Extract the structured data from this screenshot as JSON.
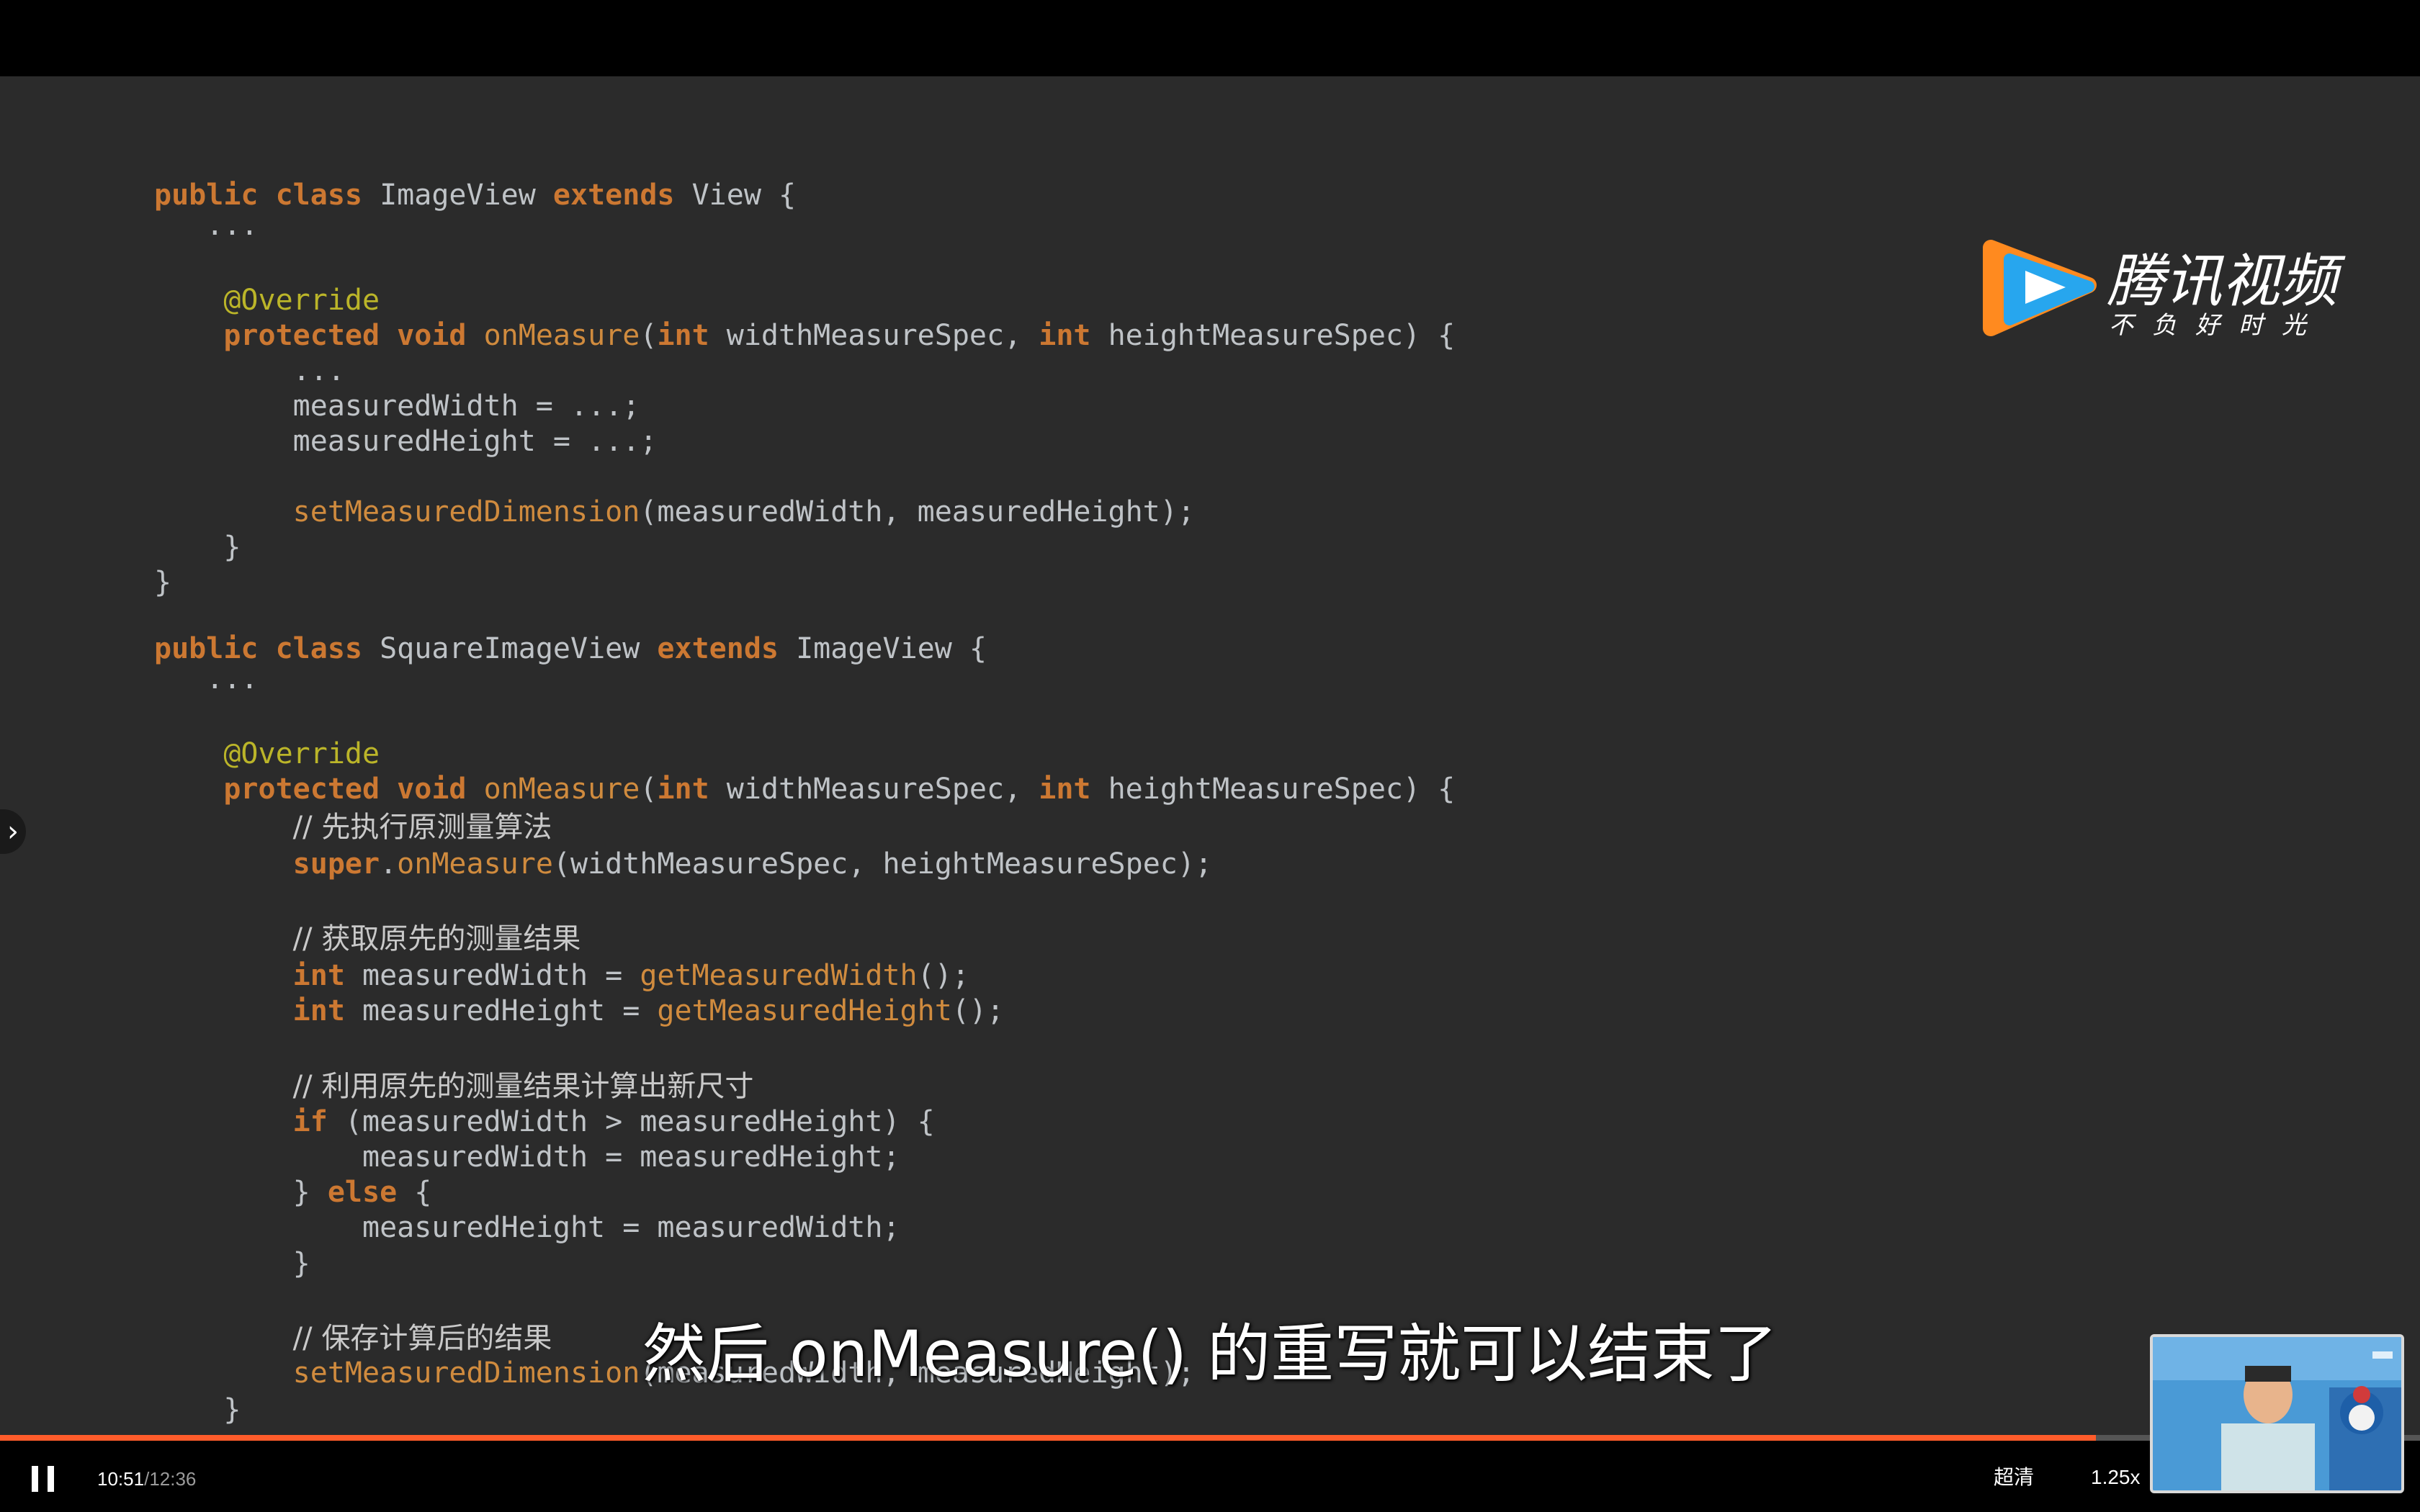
{
  "player": {
    "logo": {
      "title": "腾讯视频",
      "slogan": "不负好时光"
    },
    "subtitle": "然后 onMeasure() 的重写就可以结束了",
    "progress": {
      "current_time": "10:51",
      "separator": "/",
      "duration": "12:36",
      "played_fraction": 0.866
    },
    "controls": {
      "quality_label": "超清",
      "speed_label": "1.25x"
    },
    "side_toggle_icon": "chevron-right-icon",
    "pause_icon": "pause-icon",
    "colors": {
      "progress": "#ff5c2b",
      "background": "#2b2b2b",
      "keyword": "#cc7832"
    }
  },
  "code_lines": [
    [
      [
        "k",
        "public"
      ],
      [
        "p",
        " "
      ],
      [
        "k",
        "class"
      ],
      [
        "p",
        " ImageView "
      ],
      [
        "k",
        "extends"
      ],
      [
        "p",
        " View {"
      ]
    ],
    [
      [
        "p",
        "   ..."
      ]
    ],
    [
      [
        "p",
        ""
      ]
    ],
    [
      [
        "p",
        "    "
      ],
      [
        "a",
        "@Override"
      ]
    ],
    [
      [
        "p",
        "    "
      ],
      [
        "k",
        "protected"
      ],
      [
        "p",
        " "
      ],
      [
        "k",
        "void"
      ],
      [
        "p",
        " "
      ],
      [
        "f",
        "onMeasure"
      ],
      [
        "p",
        "("
      ],
      [
        "k",
        "int"
      ],
      [
        "p",
        " widthMeasureSpec, "
      ],
      [
        "k",
        "int"
      ],
      [
        "p",
        " heightMeasureSpec) {"
      ]
    ],
    [
      [
        "p",
        "        ..."
      ]
    ],
    [
      [
        "p",
        "        measuredWidth = ...;"
      ]
    ],
    [
      [
        "p",
        "        measuredHeight = ...;"
      ]
    ],
    [
      [
        "p",
        ""
      ]
    ],
    [
      [
        "p",
        "        "
      ],
      [
        "f",
        "setMeasuredDimension"
      ],
      [
        "p",
        "(measuredWidth, measuredHeight);"
      ]
    ],
    [
      [
        "p",
        "    }"
      ]
    ],
    [
      [
        "p",
        "}"
      ]
    ],
    [
      [
        "p",
        ""
      ]
    ],
    [
      [
        "k",
        "public"
      ],
      [
        "p",
        " "
      ],
      [
        "k",
        "class"
      ],
      [
        "p",
        " SquareImageView "
      ],
      [
        "k",
        "extends"
      ],
      [
        "p",
        " ImageView {"
      ]
    ],
    [
      [
        "p",
        "   ..."
      ]
    ],
    [
      [
        "p",
        ""
      ]
    ],
    [
      [
        "p",
        "    "
      ],
      [
        "a",
        "@Override"
      ]
    ],
    [
      [
        "p",
        "    "
      ],
      [
        "k",
        "protected"
      ],
      [
        "p",
        " "
      ],
      [
        "k",
        "void"
      ],
      [
        "p",
        " "
      ],
      [
        "f",
        "onMeasure"
      ],
      [
        "p",
        "("
      ],
      [
        "k",
        "int"
      ],
      [
        "p",
        " widthMeasureSpec, "
      ],
      [
        "k",
        "int"
      ],
      [
        "p",
        " heightMeasureSpec) {"
      ]
    ],
    [
      [
        "p",
        "        "
      ],
      [
        "c",
        "// 先执行原测量算法"
      ]
    ],
    [
      [
        "p",
        "        "
      ],
      [
        "k",
        "super"
      ],
      [
        "p",
        "."
      ],
      [
        "f",
        "onMeasure"
      ],
      [
        "p",
        "(widthMeasureSpec, heightMeasureSpec);"
      ]
    ],
    [
      [
        "p",
        ""
      ]
    ],
    [
      [
        "p",
        "        "
      ],
      [
        "c",
        "// 获取原先的测量结果"
      ]
    ],
    [
      [
        "p",
        "        "
      ],
      [
        "k",
        "int"
      ],
      [
        "p",
        " measuredWidth = "
      ],
      [
        "f",
        "getMeasuredWidth"
      ],
      [
        "p",
        "();"
      ]
    ],
    [
      [
        "p",
        "        "
      ],
      [
        "k",
        "int"
      ],
      [
        "p",
        " measuredHeight = "
      ],
      [
        "f",
        "getMeasuredHeight"
      ],
      [
        "p",
        "();"
      ]
    ],
    [
      [
        "p",
        ""
      ]
    ],
    [
      [
        "p",
        "        "
      ],
      [
        "c",
        "// 利用原先的测量结果计算出新尺寸"
      ]
    ],
    [
      [
        "p",
        "        "
      ],
      [
        "k",
        "if"
      ],
      [
        "p",
        " (measuredWidth > measuredHeight) {"
      ]
    ],
    [
      [
        "p",
        "            measuredWidth = measuredHeight;"
      ]
    ],
    [
      [
        "p",
        "        } "
      ],
      [
        "k",
        "else"
      ],
      [
        "p",
        " {"
      ]
    ],
    [
      [
        "p",
        "            measuredHeight = measuredWidth;"
      ]
    ],
    [
      [
        "p",
        "        }"
      ]
    ],
    [
      [
        "p",
        ""
      ]
    ],
    [
      [
        "p",
        "        "
      ],
      [
        "c",
        "// 保存计算后的结果"
      ]
    ],
    [
      [
        "p",
        "        "
      ],
      [
        "f",
        "setMeasuredDimension"
      ],
      [
        "p",
        "(measuredWidth, measuredHeight);"
      ]
    ],
    [
      [
        "p",
        "    }"
      ]
    ],
    [
      [
        "p",
        "}"
      ]
    ]
  ]
}
